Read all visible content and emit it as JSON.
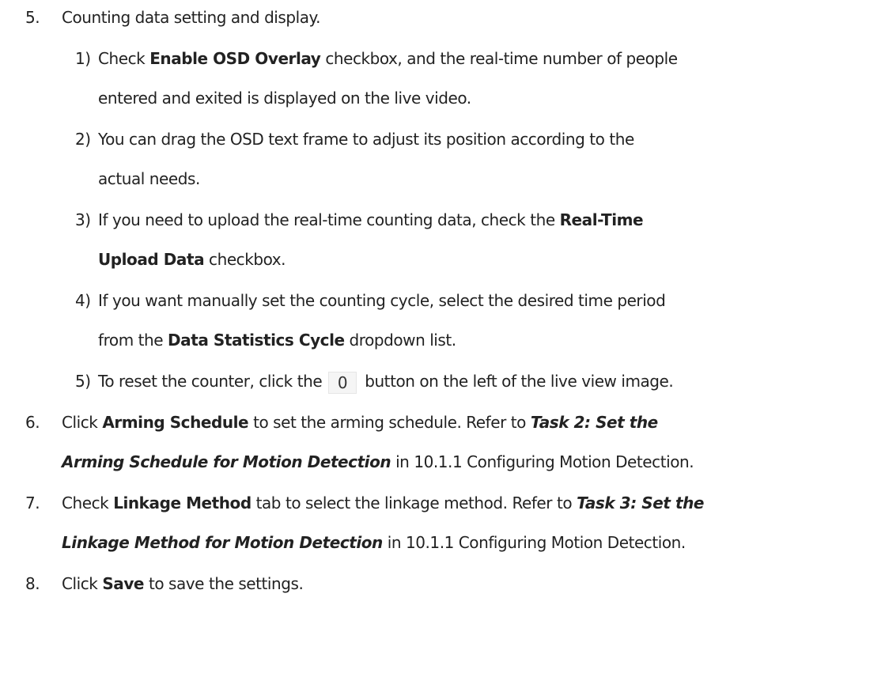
{
  "steps": {
    "s5": {
      "num": "5.",
      "text": "Counting data setting and display."
    },
    "sub1": {
      "num": "1)",
      "pre": "Check ",
      "bold": "Enable OSD Overlay",
      "post": " checkbox, and the real-time number of people",
      "line2": "entered and exited is displayed on the live video."
    },
    "sub2": {
      "num": "2)",
      "line1": "You can drag the OSD text frame to adjust its position according to the",
      "line2": "actual needs."
    },
    "sub3": {
      "num": "3)",
      "pre": "If you need to upload the real-time counting data, check the ",
      "bold1": "Real-Time",
      "bold2": "Upload Data",
      "post": " checkbox."
    },
    "sub4": {
      "num": "4)",
      "line1": "If you want manually set the counting cycle, select the desired time period",
      "pre": "from the ",
      "bold": "Data Statistics Cycle",
      "post": " dropdown list."
    },
    "sub5": {
      "num": "5)",
      "pre": "To reset the counter, click the",
      "button_label": "0",
      "post": "button on the left of the live view image."
    },
    "s6": {
      "num": "6.",
      "pre": "Click ",
      "bold": "Arming Schedule",
      "mid": " to set the arming schedule. Refer to ",
      "bi1": "Task 2: Set the",
      "bi2": "Arming Schedule for Motion Detection",
      "post": " in 10.1.1 Configuring Motion Detection."
    },
    "s7": {
      "num": "7.",
      "pre": "Check ",
      "bold": "Linkage Method",
      "mid": " tab to select the linkage method. Refer to ",
      "bi1": "Task 3: Set the",
      "bi2": "Linkage Method for Motion Detection",
      "post": " in 10.1.1 Configuring Motion Detection."
    },
    "s8": {
      "num": "8.",
      "pre": "Click ",
      "bold": "Save",
      "post": " to save the settings."
    }
  }
}
